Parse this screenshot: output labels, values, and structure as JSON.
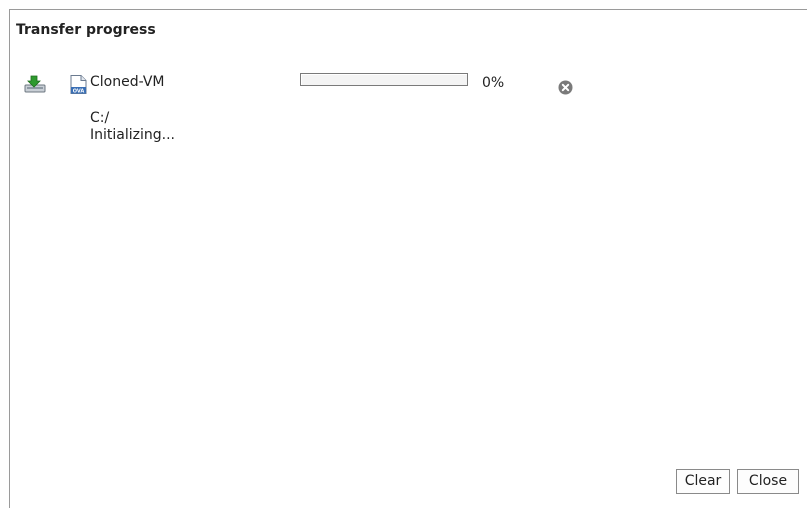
{
  "dialog": {
    "title": "Transfer progress"
  },
  "transfer": {
    "icon": "download-icon",
    "file_icon": "ova-file-icon",
    "file_name": "Cloned-VM",
    "progress_fraction": 0,
    "percent_label": "0%",
    "cancel_icon": "cancel-icon",
    "path": "C:/",
    "status": "Initializing..."
  },
  "buttons": {
    "clear_label": "Clear",
    "close_label": "Close"
  },
  "colors": {
    "progress_fill": "#4a8bd6",
    "cancel_icon": "#7a7a7a",
    "download_arrow": "#2e9a2e"
  }
}
